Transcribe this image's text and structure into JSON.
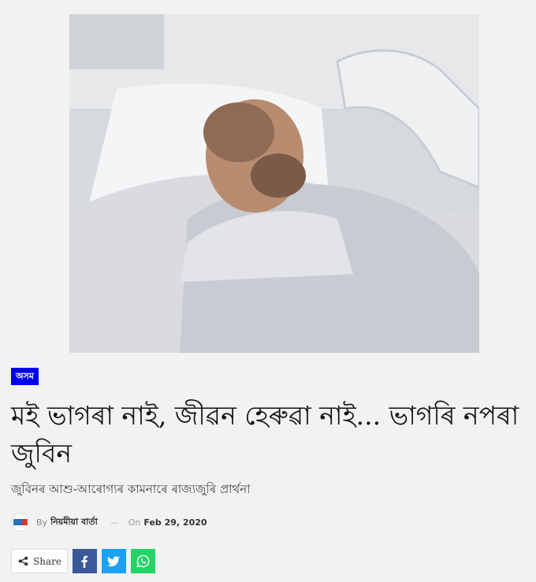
{
  "article": {
    "category": "অসম",
    "title": "মই ভাগৰা নাই, জীৱন হেৰুৱা নাই... ভাগৰি নপৰা জুবিন",
    "subtitle": "জুবিনৰ আশু-আৰোগ্যৰ কামনাৰে ৰাজ্যজুৰি প্ৰাৰ্থনা"
  },
  "meta": {
    "by_label": "By",
    "author": "নিয়মীয়া বাৰ্তা",
    "separator": "—",
    "on_label": "On",
    "date": "Feb 29, 2020"
  },
  "share": {
    "label": "Share",
    "icons": [
      "share-icon",
      "facebook-icon",
      "twitter-icon",
      "whatsapp-icon"
    ]
  },
  "colors": {
    "category_bg": "#0000ee",
    "facebook": "#3b5998",
    "twitter": "#1da1f2",
    "whatsapp": "#25d366"
  }
}
